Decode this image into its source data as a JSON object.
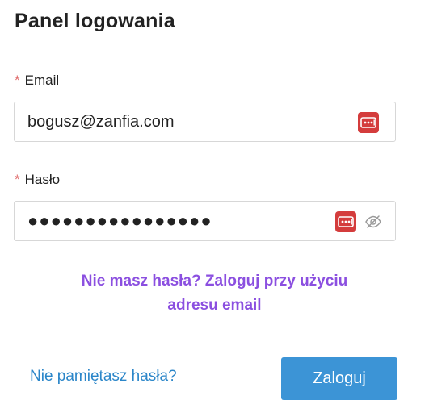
{
  "panel": {
    "title": "Panel logowania"
  },
  "email": {
    "required_mark": "*",
    "label": "Email",
    "value": "bogusz@zanfia.com",
    "icon": "password-manager-icon"
  },
  "password": {
    "required_mark": "*",
    "label": "Hasło",
    "value": "●●●●●●●●●●●●●●●●",
    "icon": "password-manager-icon",
    "toggle_icon": "eye-slash-icon"
  },
  "promo": {
    "line1": "Nie masz hasła? Zaloguj przy użyciu",
    "line2": "adresu email"
  },
  "actions": {
    "forgot_label": "Nie pamiętasz hasła?",
    "submit_label": "Zaloguj"
  },
  "colors": {
    "accent_purple": "#8b4fe0",
    "link_blue": "#2b86c9",
    "button_blue": "#3c94d6",
    "required_red": "#e06c6c",
    "pm_icon_red": "#d43c3c"
  }
}
